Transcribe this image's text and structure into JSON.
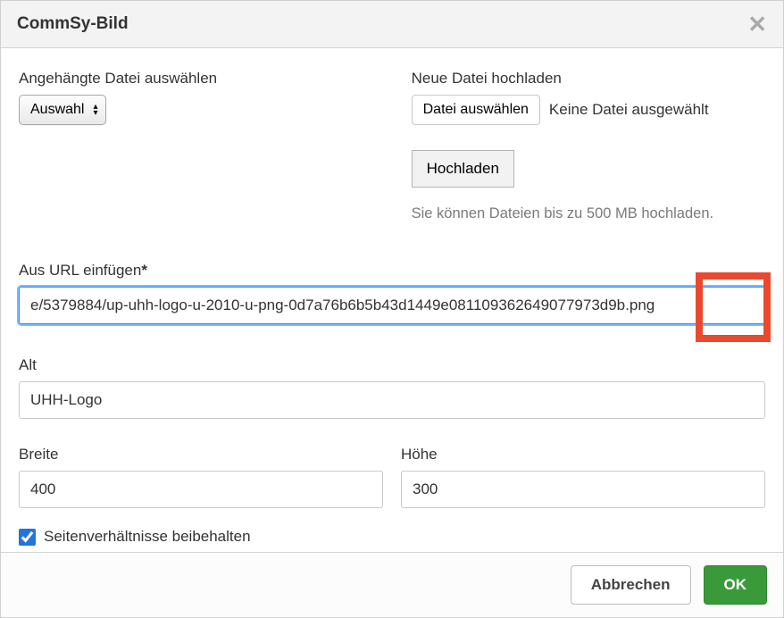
{
  "dialog": {
    "title": "CommSy-Bild"
  },
  "attachedFile": {
    "label": "Angehängte Datei auswählen",
    "selectValue": "Auswahl"
  },
  "upload": {
    "label": "Neue Datei hochladen",
    "chooseButton": "Datei auswählen",
    "statusText": "Keine Datei ausgewählt",
    "uploadButton": "Hochladen",
    "hint": "Sie können Dateien bis zu 500 MB hochladen."
  },
  "url": {
    "label": "Aus URL einfügen",
    "required": "*",
    "value": "e/5379884/up-uhh-logo-u-2010-u-png-0d7a76b6b5b43d1449e081109362649077973d9b.png"
  },
  "alt": {
    "label": "Alt",
    "value": "UHH-Logo"
  },
  "width": {
    "label": "Breite",
    "value": "400"
  },
  "height": {
    "label": "Höhe",
    "value": "300"
  },
  "aspect": {
    "label": "Seitenverhältnisse beibehalten",
    "checked": true
  },
  "footer": {
    "cancel": "Abbrechen",
    "ok": "OK"
  }
}
